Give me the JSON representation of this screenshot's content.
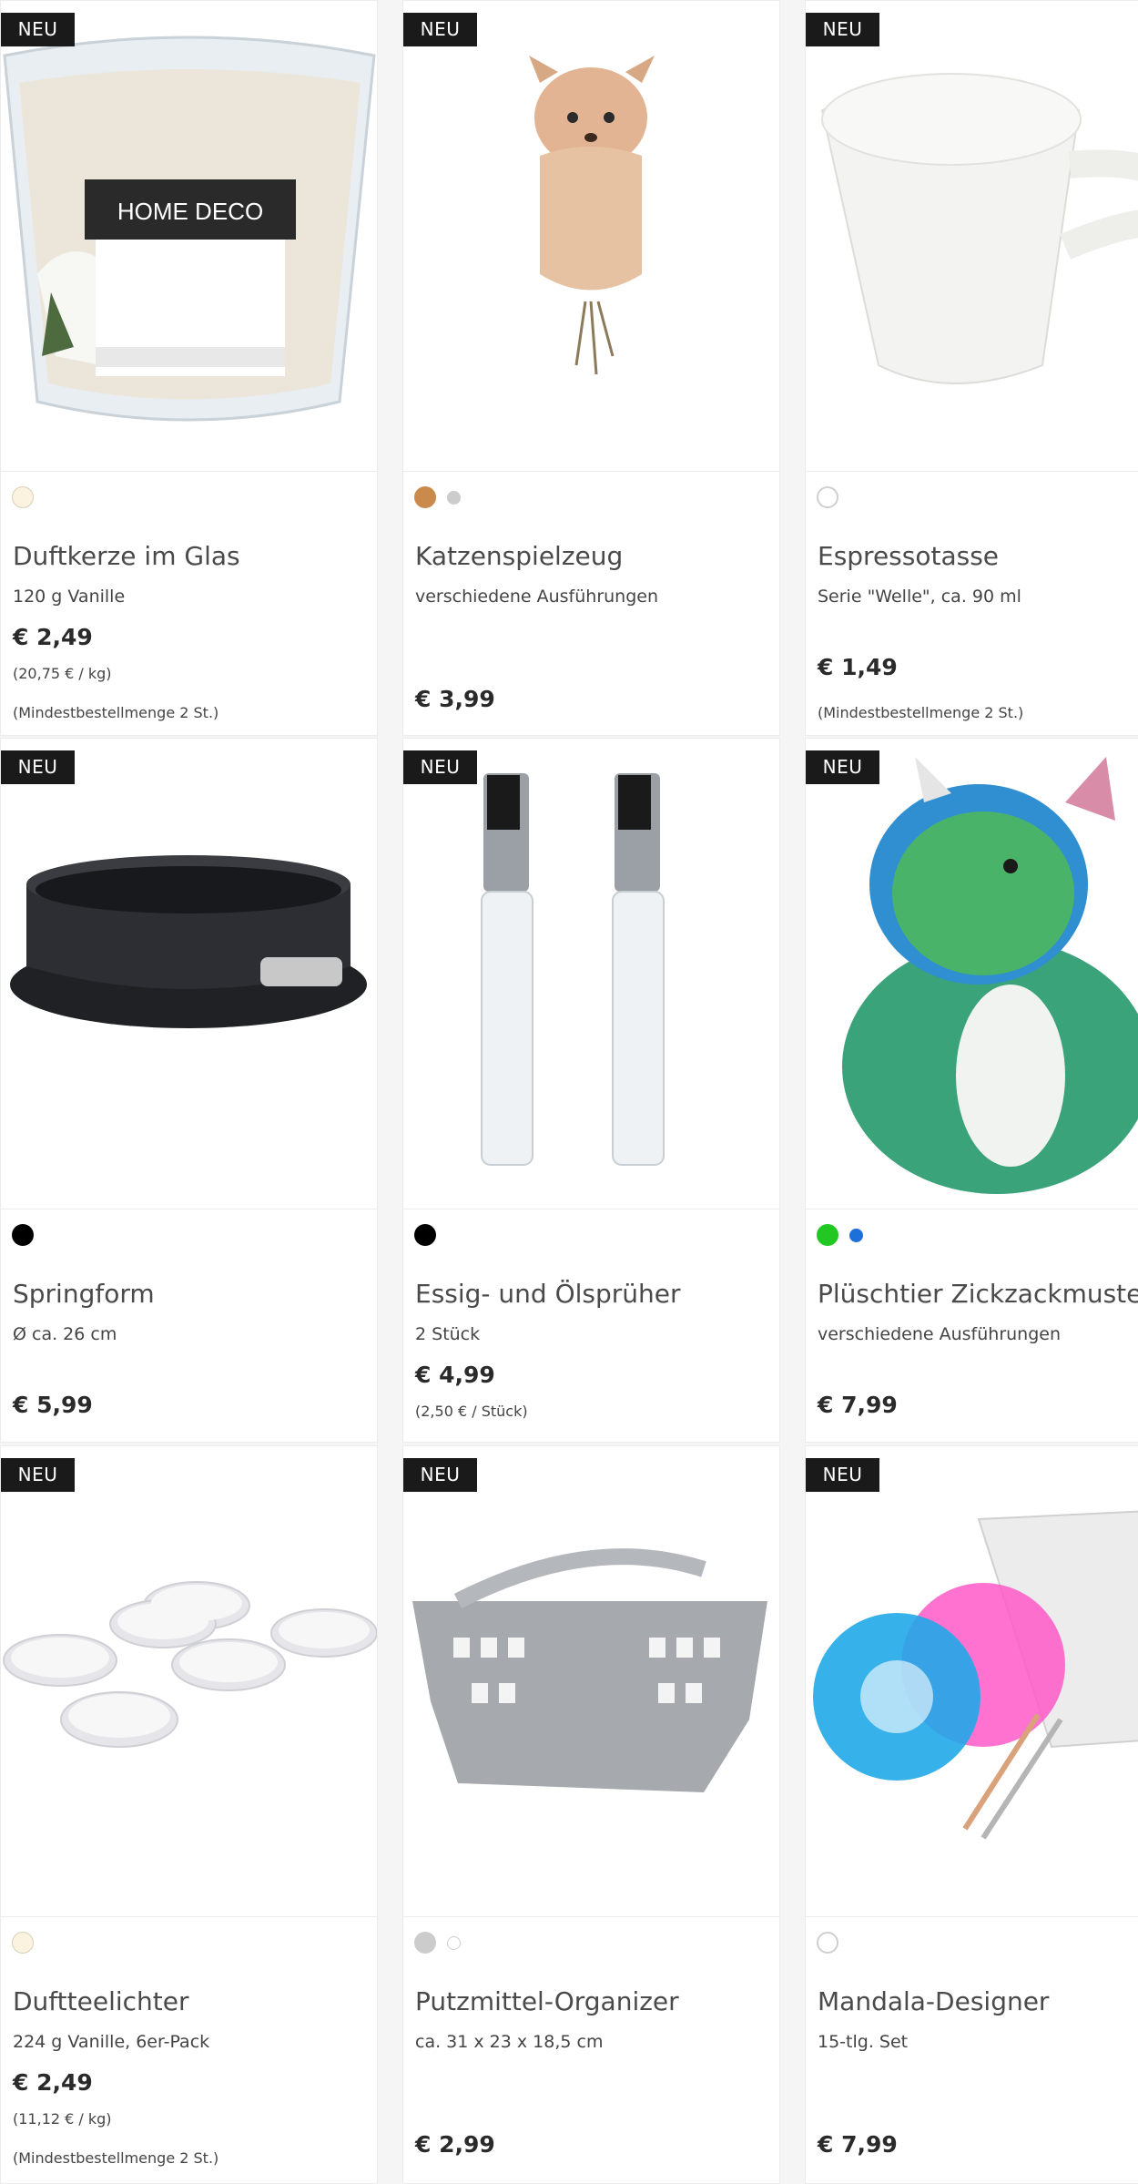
{
  "badge_text": "NEU",
  "products": [
    {
      "title": "Duftkerze im Glas",
      "subtitle": "120 g Vanille",
      "price": "€ 2,49",
      "unit_price": "(20,75 € / kg)",
      "min_order": "(Mindestbestellmenge 2 St.)",
      "swatches": [
        "#fbf3e0"
      ],
      "image": "candle-jar-image",
      "image_label": "HOME DECO"
    },
    {
      "title": "Katzenspielzeug",
      "subtitle": "verschiedene Ausführungen",
      "price": "€ 3,99",
      "swatches": [
        "#c98a4b",
        "#cccccc"
      ],
      "image": "plush-fawn-toy-image"
    },
    {
      "title": "Espressotasse",
      "subtitle": "Serie \"Welle\", ca. 90 ml",
      "price": "€ 1,49",
      "min_order": "(Mindestbestellmenge 2 St.)",
      "swatches": [
        "#ffffff"
      ],
      "image": "espresso-cup-image"
    },
    {
      "title": "Springform",
      "subtitle": "Ø ca. 26 cm",
      "price": "€ 5,99",
      "swatches": [
        "#000000"
      ],
      "image": "springform-pan-image"
    },
    {
      "title": "Essig- und Ölsprüher",
      "subtitle": "2 Stück",
      "price": "€ 4,99",
      "unit_price": "(2,50 € / Stück)",
      "swatches": [
        "#000000"
      ],
      "image": "oil-sprayer-bottles-image"
    },
    {
      "title": "Plüschtier Zickzackmuster",
      "subtitle": "verschiedene Ausführungen",
      "price": "€ 7,99",
      "swatches": [
        "#22c722",
        "#1e6fd9"
      ],
      "image": "plush-dragon-image"
    },
    {
      "title": "Duftteelichter",
      "subtitle": "224 g Vanille, 6er-Pack",
      "price": "€ 2,49",
      "unit_price": "(11,12 € / kg)",
      "min_order": "(Mindestbestellmenge 2 St.)",
      "swatches": [
        "#fbf3e0"
      ],
      "image": "tealights-image"
    },
    {
      "title": "Putzmittel-Organizer",
      "subtitle": "ca. 31 x 23 x 18,5 cm",
      "price": "€ 2,99",
      "swatches": [
        "#cccccc",
        "#ffffff"
      ],
      "image": "cleaning-caddy-image"
    },
    {
      "title": "Mandala-Designer",
      "subtitle": "15-tlg. Set",
      "price": "€ 7,99",
      "swatches": [
        "#ffffff"
      ],
      "image": "mandala-stencil-set-image"
    }
  ]
}
